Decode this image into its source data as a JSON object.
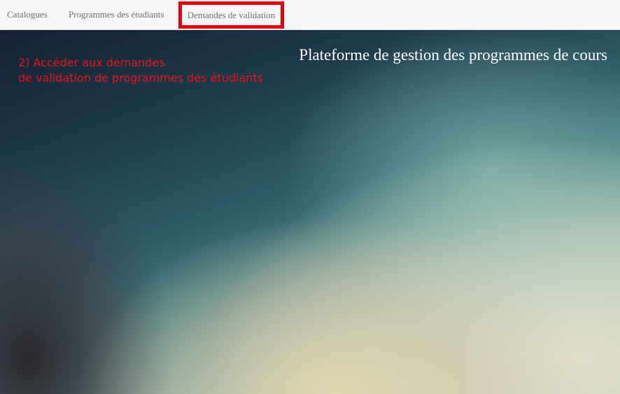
{
  "navbar": {
    "items": [
      {
        "label": "Catalogues"
      },
      {
        "label": "Programmes des étudiants"
      },
      {
        "label": "Demandes de validation"
      }
    ]
  },
  "annotation": {
    "line1": "2) Accéder aux demandes",
    "line2": "de validation de programmes des étudiants",
    "color": "#e8131b"
  },
  "hero": {
    "title": "Plateforme de gestion des programmes de cours"
  },
  "colors": {
    "highlight_border": "#e4000f",
    "navbar_bg": "#f7f7f7"
  }
}
